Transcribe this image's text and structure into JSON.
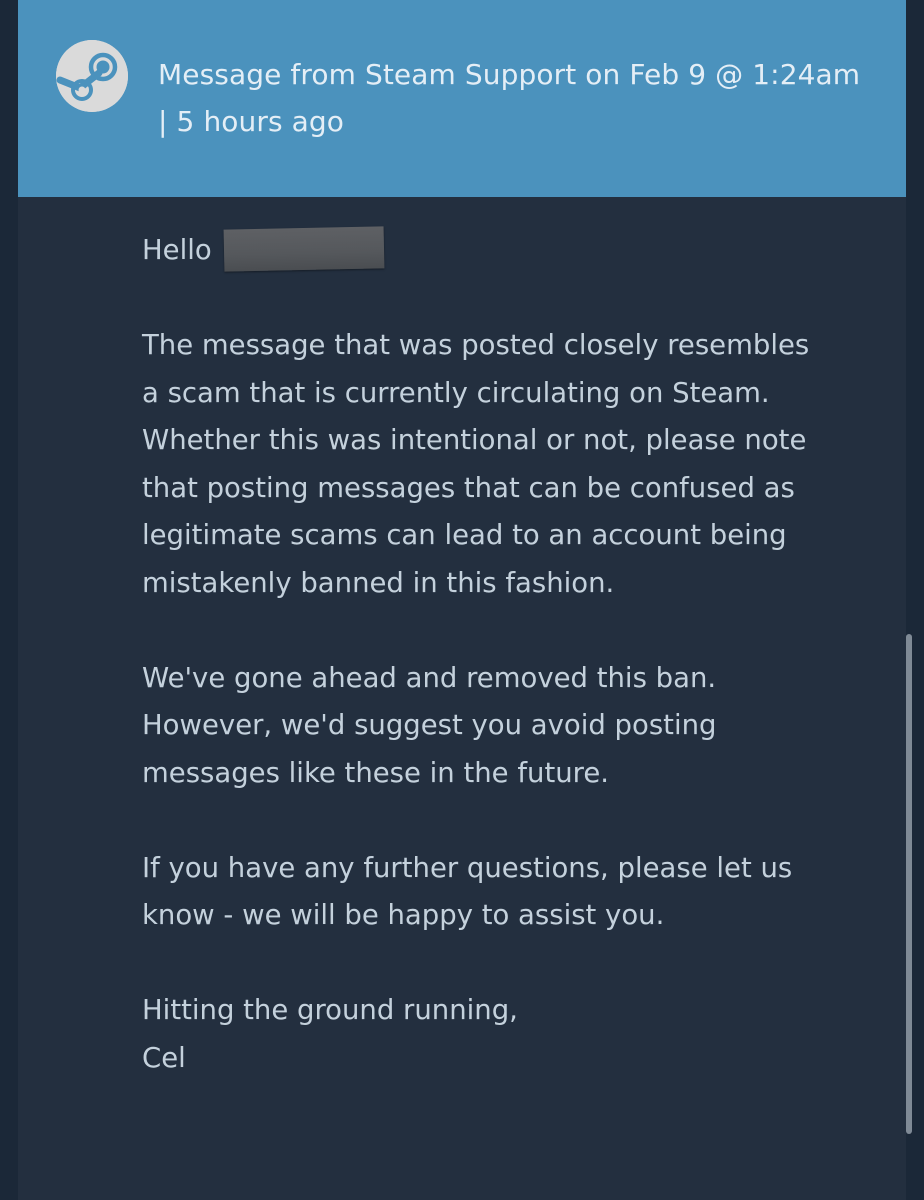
{
  "header": {
    "avatar_icon": "steam-logo-icon",
    "title_line1": "Message from Steam Support on Feb 9 @ 1:24am",
    "title_line2": "| 5 hours ago"
  },
  "message": {
    "greeting": "Hello",
    "paragraphs": [
      "The message that was posted closely resembles a scam that is currently circulating on Steam. Whether this was intentional or not, please note that posting messages that can be confused as legitimate scams can lead to an account being mistakenly banned in this fashion.",
      "We've gone ahead and removed this ban. However, we'd suggest you avoid posting messages like these in the future.",
      "If you have any further questions, please let us know - we will be happy to assist you."
    ],
    "signoff": "Hitting the ground running,",
    "signature": "Cel"
  },
  "colors": {
    "header_bg": "#4b92bd",
    "card_bg": "#232f3f",
    "page_bg": "#1b2838",
    "body_text": "#c4d1dc"
  }
}
